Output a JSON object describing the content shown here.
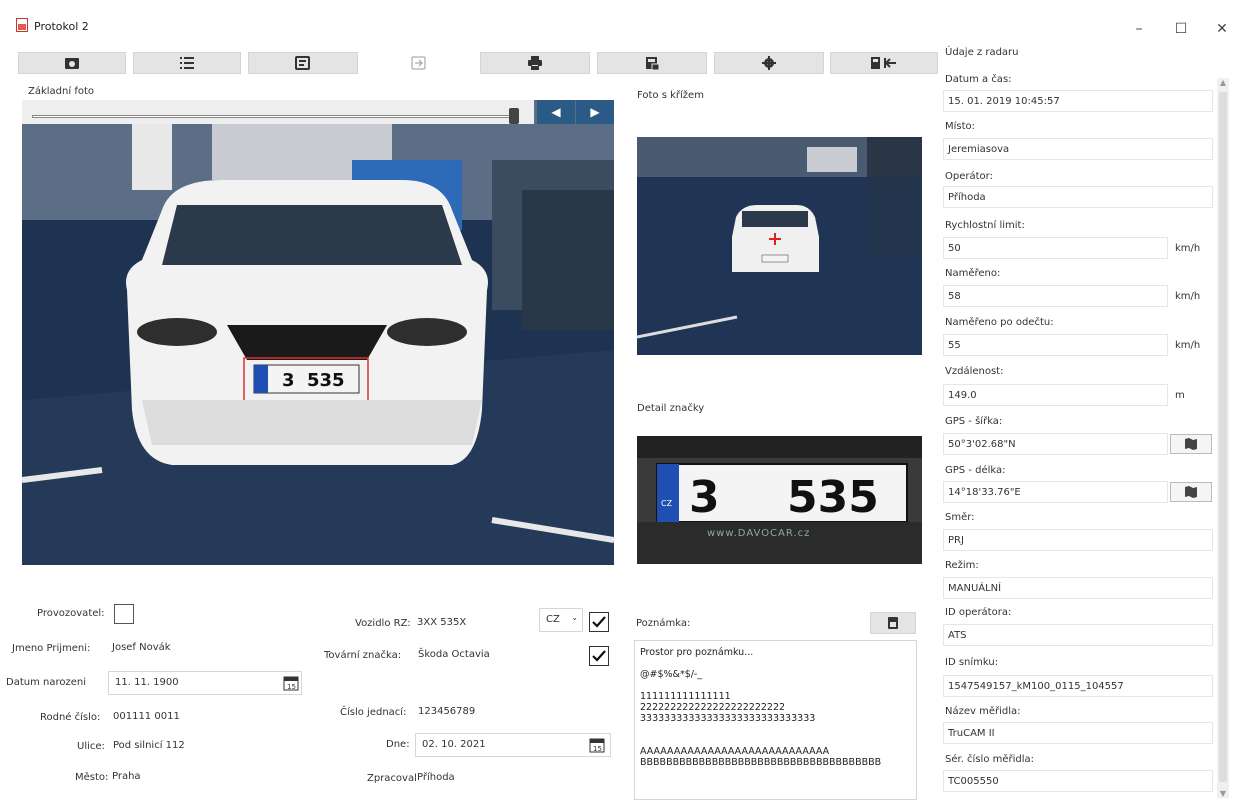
{
  "window": {
    "title": "Protokol 2",
    "minimize": "–",
    "maximize": "☐",
    "close": "✕"
  },
  "toolbar": {
    "icons": [
      "folder-camera-icon",
      "list-icon",
      "image-export-icon",
      "import-icon",
      "print-icon",
      "document-save-icon",
      "settings-gear-icon",
      "exit-icon"
    ]
  },
  "photos": {
    "main_label": "Základní foto",
    "cross_label": "Foto s křížem",
    "detail_label": "Detail značky",
    "plate_left": "3",
    "plate_right": "535",
    "plate_dealer": "www.DAVOCAR.cz",
    "plate_country": "CZ"
  },
  "form": {
    "operator_label": "Provozovatel:",
    "name_label": "Jmeno Prijmeni:",
    "name_value": "Josef Novák",
    "birth_label": "Datum narozeni",
    "birth_value": "11. 11. 1900",
    "birthnum_label": "Rodné číslo:",
    "birthnum_value": "001111 0011",
    "street_label": "Ulice:",
    "street_value": "Pod silnicí 112",
    "city_label": "Město:",
    "city_value": "Praha",
    "plate_label": "Vozidlo RZ:",
    "plate_value": "3XX 535X",
    "country_value": "CZ",
    "brand_label": "Tovární značka:",
    "brand_value": "Škoda Octavia",
    "ref_label": "Číslo jednací:",
    "ref_value": "123456789",
    "date_label": "Dne:",
    "date_value": "02. 10. 2021",
    "processed_label": "Zpracoval:",
    "processed_value": "Příhoda",
    "note_label": "Poznámka:",
    "note_text": "Prostor pro poznámku...\n\n@#$%&*$/-_\n\n111111111111111\n222222222222222222222222\n33333333333333333333333333333\n\n\nAAAAAAAAAAAAAAAAAAAAAAAAAAAA\nBBBBBBBBBBBBBBBBBBBBBBBBBBBBBBBBBBBBB"
  },
  "radar": {
    "header": "Údaje z radaru",
    "datetime_label": "Datum a čas:",
    "datetime_value": "15. 01. 2019 10:45:57",
    "place_label": "Místo:",
    "place_value": "Jeremiasova",
    "operator_label": "Operátor:",
    "operator_value": "Příhoda",
    "limit_label": "Rychlostní limit:",
    "limit_value": "50",
    "limit_unit": "km/h",
    "measured_label": "Naměřeno:",
    "measured_value": "58",
    "measured_unit": "km/h",
    "deducted_label": "Naměřeno po odečtu:",
    "deducted_value": "55",
    "deducted_unit": "km/h",
    "distance_label": "Vzdálenost:",
    "distance_value": "149.0",
    "distance_unit": "m",
    "lat_label": "GPS - šířka:",
    "lat_value": "50°3'02.68\"N",
    "lon_label": "GPS - délka:",
    "lon_value": "14°18'33.76\"E",
    "direction_label": "Směr:",
    "direction_value": "PRJ",
    "mode_label": "Režim:",
    "mode_value": "MANUÁLNÍ",
    "opid_label": "ID operátora:",
    "opid_value": "ATS",
    "frame_label": "ID snímku:",
    "frame_value": "1547549157_kM100_0115_104557",
    "device_label": "Název měřidla:",
    "device_value": "TruCAM II",
    "serial_label": "Sér. číslo měřidla:",
    "serial_value": "TC005550"
  }
}
